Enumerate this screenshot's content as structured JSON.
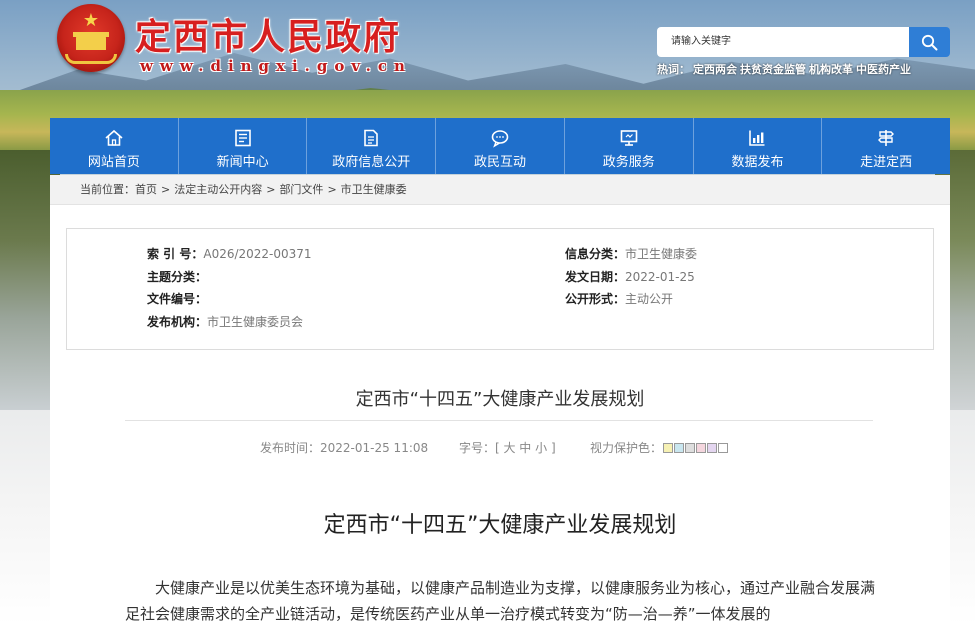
{
  "header": {
    "site_title": "定西市人民政府",
    "site_url": "www.dingxi.gov.cn",
    "search_placeholder": "请输入关键字",
    "hot_label": "热词：",
    "hot_words": [
      "定西两会",
      "扶贫资金监管",
      "机构改革",
      "中医药产业"
    ]
  },
  "nav": {
    "items": [
      {
        "label": "网站首页",
        "icon": "home-icon"
      },
      {
        "label": "新闻中心",
        "icon": "news-icon"
      },
      {
        "label": "政府信息公开",
        "icon": "document-icon"
      },
      {
        "label": "政民互动",
        "icon": "chat-icon"
      },
      {
        "label": "政务服务",
        "icon": "monitor-icon"
      },
      {
        "label": "数据发布",
        "icon": "chart-icon"
      },
      {
        "label": "走进定西",
        "icon": "signpost-icon"
      }
    ]
  },
  "breadcrumb": {
    "prefix": "当前位置：",
    "items": [
      "首页",
      "法定主动公开内容",
      "部门文件",
      "市卫生健康委"
    ],
    "separator": ">"
  },
  "meta": {
    "index_label": "索 引 号：",
    "index_value": "A026/2022-00371",
    "topic_label": "主题分类：",
    "topic_value": "",
    "docno_label": "文件编号：",
    "docno_value": "",
    "org_label": "发布机构：",
    "org_value": "市卫生健康委员会",
    "category_label": "信息分类：",
    "category_value": "市卫生健康委",
    "date_label": "发文日期：",
    "date_value": "2022-01-25",
    "form_label": "公开形式：",
    "form_value": "主动公开"
  },
  "article": {
    "title": "定西市“十四五”大健康产业发展规划",
    "publish_time": "发布时间：2022-01-25 11:08",
    "font_size_label": "字号：[ 大 中 小 ]",
    "eye_protect_label": "视力保护色：",
    "eye_colors": [
      "#f6f1b4",
      "#c9e6ef",
      "#dedede",
      "#f4d6de",
      "#e4d6f0",
      "#ffffff"
    ],
    "heading": "定西市“十四五”大健康产业发展规划",
    "body": "大健康产业是以优美生态环境为基础，以健康产品制造业为支撑，以健康服务业为核心，通过产业融合发展满足社会健康需求的全产业链活动，是传统医药产业从单一治疗模式转变为“防—治—养”一体发展的"
  },
  "colors": {
    "nav_bg": "#1f6fcb",
    "title_red": "#d71f1f",
    "search_btn": "#2f7ed6"
  }
}
